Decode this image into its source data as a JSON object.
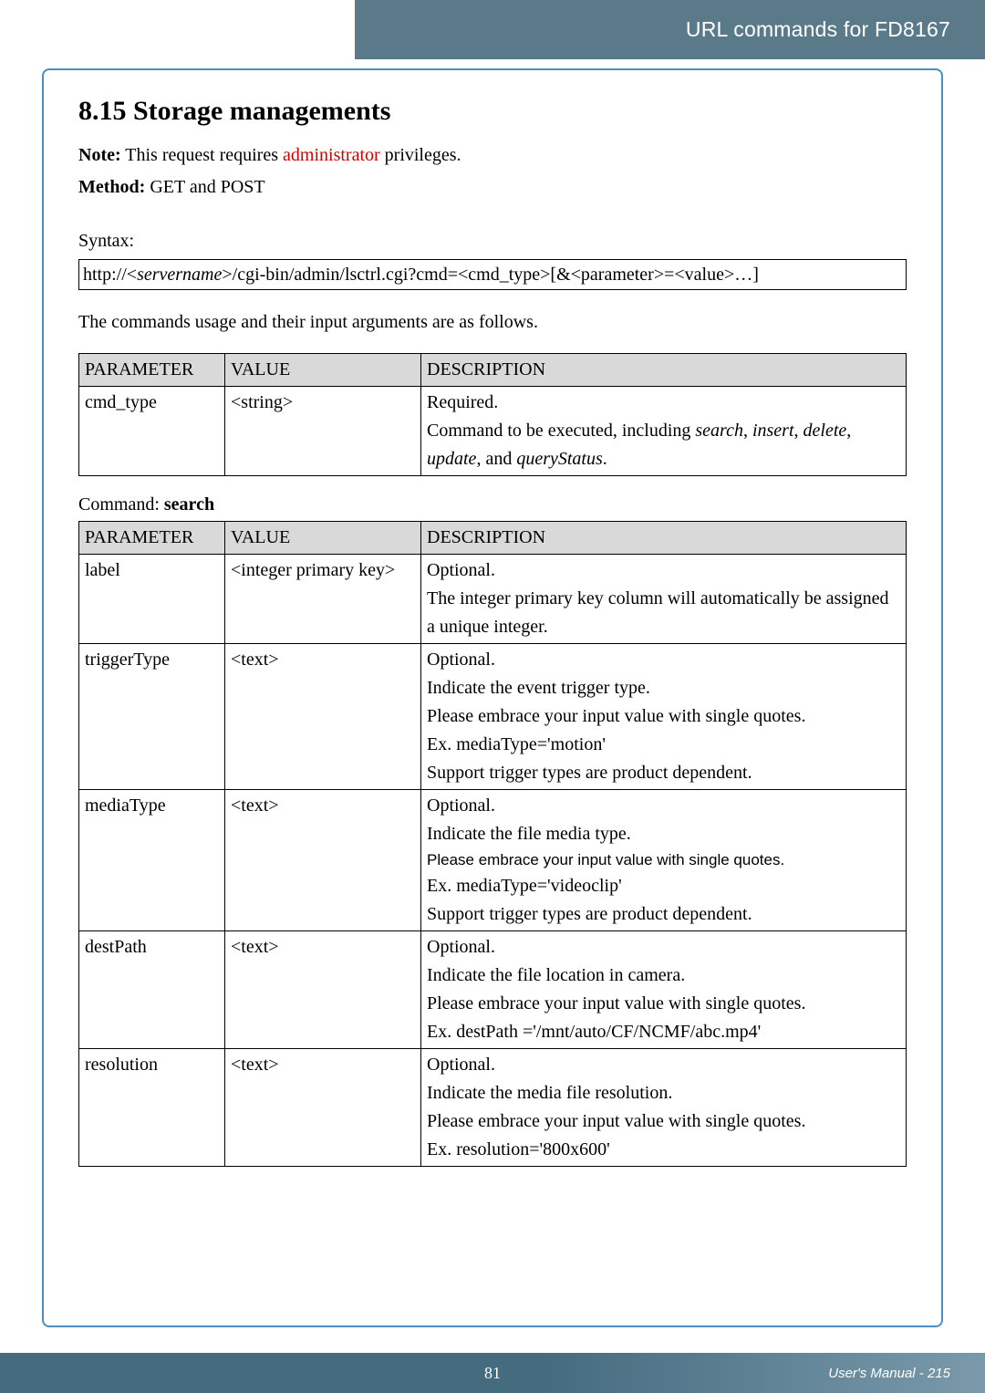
{
  "header": {
    "title": "URL commands for FD8167"
  },
  "section": {
    "heading": "8.15 Storage managements",
    "note_label": "Note:",
    "note_text_pre": " This request requires ",
    "note_admin": "administrator",
    "note_text_post": " privileges.",
    "method_label": "Method:",
    "method_text": " GET and POST",
    "syntax_label": "Syntax:",
    "syntax_prefix": "http://<",
    "syntax_server": "servername",
    "syntax_rest": ">/cgi-bin/admin/lsctrl.cgi?cmd=<cmd_type>[&<parameter>=<value>…]",
    "usage_text": "The commands usage and their input arguments are as follows.",
    "command_label": "Command: ",
    "command_name": "search"
  },
  "table1": {
    "headers": {
      "p": "PARAMETER",
      "v": "VALUE",
      "d": "DESCRIPTION"
    },
    "rows": [
      {
        "param": "cmd_type",
        "value": "<string>",
        "desc": {
          "l1": "Required.",
          "l2a": "Command to be executed, including ",
          "l2b": "search",
          "l2c": ", ",
          "l2d": "insert",
          "l2e": ", ",
          "l2f": "delete",
          "l2g": ", ",
          "l3a": "update",
          "l3b": ", and ",
          "l3c": "queryStatus",
          "l3d": "."
        }
      }
    ]
  },
  "table2": {
    "headers": {
      "p": "PARAMETER",
      "v": "VALUE",
      "d": "DESCRIPTION"
    },
    "rows": [
      {
        "param": "label",
        "value": "<integer primary key>",
        "desc": [
          "Optional.",
          "The integer primary key column will automatically be assigned a unique integer."
        ]
      },
      {
        "param": "triggerType",
        "value": "<text>",
        "desc": [
          "Optional.",
          "Indicate the event trigger type.",
          "Please embrace your input value with single quotes.",
          "Ex. mediaType='motion'",
          "Support trigger types are product dependent."
        ]
      },
      {
        "param": "mediaType",
        "value": "<text>",
        "desc": [
          "Optional.",
          "Indicate the file media type.",
          {
            "sans": "Please embrace your input value with single quotes."
          },
          "Ex. mediaType='videoclip'",
          "Support trigger types are product dependent."
        ]
      },
      {
        "param": "destPath",
        "value": "<text>",
        "desc": [
          "Optional.",
          "Indicate the file location in camera.",
          "Please embrace your input value with single quotes.",
          "Ex. destPath ='/mnt/auto/CF/NCMF/abc.mp4'"
        ]
      },
      {
        "param": "resolution",
        "value": "<text>",
        "desc": [
          "Optional.",
          "Indicate the media file resolution.",
          "Please embrace your input value with single quotes.",
          "Ex. resolution='800x600'"
        ]
      }
    ]
  },
  "footer": {
    "page_number": "81",
    "manual": "User's Manual - 215"
  }
}
